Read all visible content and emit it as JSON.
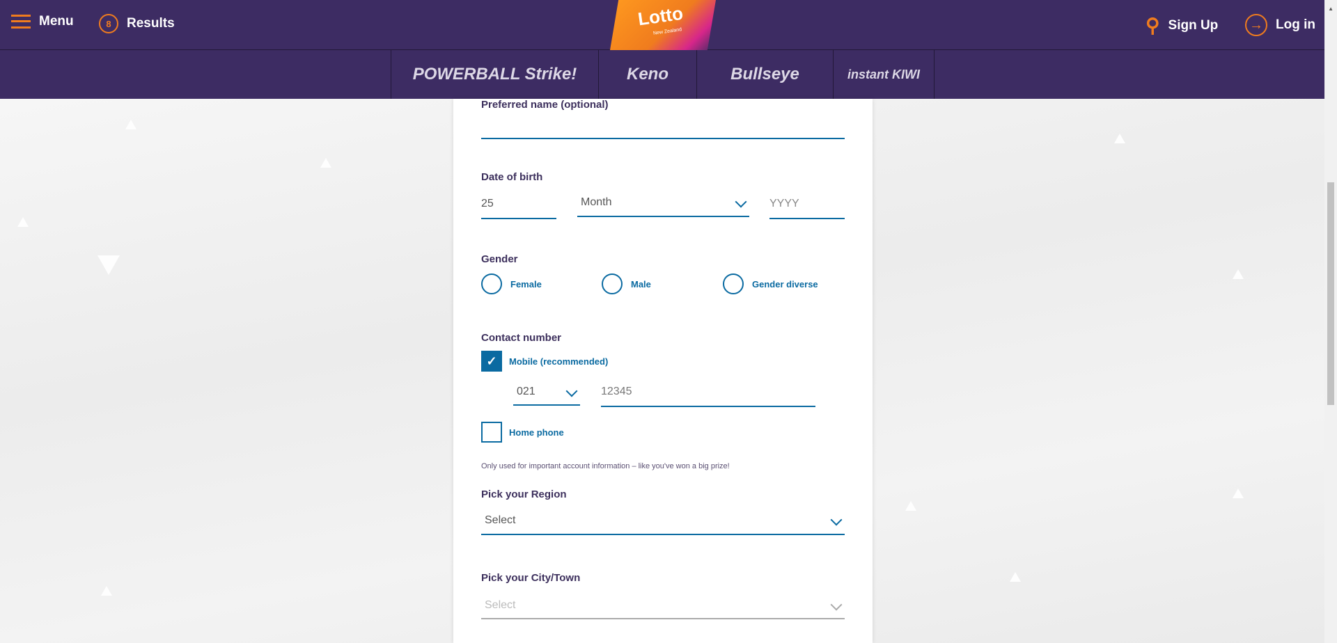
{
  "header": {
    "menu": "Menu",
    "results": "Results",
    "results_badge": "8",
    "logo_text": "Lotto",
    "logo_sub": "New Zealand",
    "sign_up": "Sign Up",
    "log_in": "Log in"
  },
  "games": [
    "POWERBALL Strike!",
    "Keno",
    "Bullseye",
    "instant KIWI"
  ],
  "form": {
    "preferred_name_label": "Preferred name (optional)",
    "preferred_name_value": "",
    "dob_label": "Date of birth",
    "dob_day": "25",
    "dob_month": "Month",
    "dob_year_placeholder": "YYYY",
    "gender_label": "Gender",
    "gender_options": [
      "Female",
      "Male",
      "Gender diverse"
    ],
    "contact_label": "Contact number",
    "mobile_label": "Mobile (recommended)",
    "mobile_checked": true,
    "prefix": "021",
    "number": "12345",
    "home_label": "Home phone",
    "home_checked": false,
    "note": "Only used for important account information – like you've won a big prize!",
    "region_label": "Pick your Region",
    "region_value": "Select",
    "city_label": "Pick your City/Town",
    "city_value": "Select"
  },
  "colors": {
    "brand": "#3d2c63",
    "accent": "#f07c1e",
    "field": "#0a6aa1"
  }
}
